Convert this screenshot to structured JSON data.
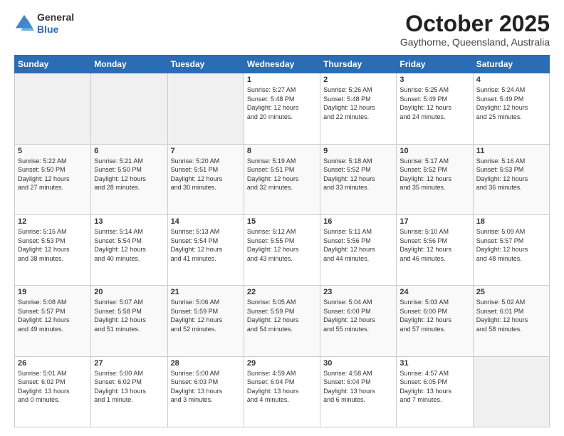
{
  "logo": {
    "general": "General",
    "blue": "Blue"
  },
  "header": {
    "month": "October 2025",
    "location": "Gaythorne, Queensland, Australia"
  },
  "weekdays": [
    "Sunday",
    "Monday",
    "Tuesday",
    "Wednesday",
    "Thursday",
    "Friday",
    "Saturday"
  ],
  "weeks": [
    [
      {
        "day": "",
        "info": ""
      },
      {
        "day": "",
        "info": ""
      },
      {
        "day": "",
        "info": ""
      },
      {
        "day": "1",
        "info": "Sunrise: 5:27 AM\nSunset: 5:48 PM\nDaylight: 12 hours\nand 20 minutes."
      },
      {
        "day": "2",
        "info": "Sunrise: 5:26 AM\nSunset: 5:48 PM\nDaylight: 12 hours\nand 22 minutes."
      },
      {
        "day": "3",
        "info": "Sunrise: 5:25 AM\nSunset: 5:49 PM\nDaylight: 12 hours\nand 24 minutes."
      },
      {
        "day": "4",
        "info": "Sunrise: 5:24 AM\nSunset: 5:49 PM\nDaylight: 12 hours\nand 25 minutes."
      }
    ],
    [
      {
        "day": "5",
        "info": "Sunrise: 5:22 AM\nSunset: 5:50 PM\nDaylight: 12 hours\nand 27 minutes."
      },
      {
        "day": "6",
        "info": "Sunrise: 5:21 AM\nSunset: 5:50 PM\nDaylight: 12 hours\nand 28 minutes."
      },
      {
        "day": "7",
        "info": "Sunrise: 5:20 AM\nSunset: 5:51 PM\nDaylight: 12 hours\nand 30 minutes."
      },
      {
        "day": "8",
        "info": "Sunrise: 5:19 AM\nSunset: 5:51 PM\nDaylight: 12 hours\nand 32 minutes."
      },
      {
        "day": "9",
        "info": "Sunrise: 5:18 AM\nSunset: 5:52 PM\nDaylight: 12 hours\nand 33 minutes."
      },
      {
        "day": "10",
        "info": "Sunrise: 5:17 AM\nSunset: 5:52 PM\nDaylight: 12 hours\nand 35 minutes."
      },
      {
        "day": "11",
        "info": "Sunrise: 5:16 AM\nSunset: 5:53 PM\nDaylight: 12 hours\nand 36 minutes."
      }
    ],
    [
      {
        "day": "12",
        "info": "Sunrise: 5:15 AM\nSunset: 5:53 PM\nDaylight: 12 hours\nand 38 minutes."
      },
      {
        "day": "13",
        "info": "Sunrise: 5:14 AM\nSunset: 5:54 PM\nDaylight: 12 hours\nand 40 minutes."
      },
      {
        "day": "14",
        "info": "Sunrise: 5:13 AM\nSunset: 5:54 PM\nDaylight: 12 hours\nand 41 minutes."
      },
      {
        "day": "15",
        "info": "Sunrise: 5:12 AM\nSunset: 5:55 PM\nDaylight: 12 hours\nand 43 minutes."
      },
      {
        "day": "16",
        "info": "Sunrise: 5:11 AM\nSunset: 5:56 PM\nDaylight: 12 hours\nand 44 minutes."
      },
      {
        "day": "17",
        "info": "Sunrise: 5:10 AM\nSunset: 5:56 PM\nDaylight: 12 hours\nand 46 minutes."
      },
      {
        "day": "18",
        "info": "Sunrise: 5:09 AM\nSunset: 5:57 PM\nDaylight: 12 hours\nand 48 minutes."
      }
    ],
    [
      {
        "day": "19",
        "info": "Sunrise: 5:08 AM\nSunset: 5:57 PM\nDaylight: 12 hours\nand 49 minutes."
      },
      {
        "day": "20",
        "info": "Sunrise: 5:07 AM\nSunset: 5:58 PM\nDaylight: 12 hours\nand 51 minutes."
      },
      {
        "day": "21",
        "info": "Sunrise: 5:06 AM\nSunset: 5:59 PM\nDaylight: 12 hours\nand 52 minutes."
      },
      {
        "day": "22",
        "info": "Sunrise: 5:05 AM\nSunset: 5:59 PM\nDaylight: 12 hours\nand 54 minutes."
      },
      {
        "day": "23",
        "info": "Sunrise: 5:04 AM\nSunset: 6:00 PM\nDaylight: 12 hours\nand 55 minutes."
      },
      {
        "day": "24",
        "info": "Sunrise: 5:03 AM\nSunset: 6:00 PM\nDaylight: 12 hours\nand 57 minutes."
      },
      {
        "day": "25",
        "info": "Sunrise: 5:02 AM\nSunset: 6:01 PM\nDaylight: 12 hours\nand 58 minutes."
      }
    ],
    [
      {
        "day": "26",
        "info": "Sunrise: 5:01 AM\nSunset: 6:02 PM\nDaylight: 13 hours\nand 0 minutes."
      },
      {
        "day": "27",
        "info": "Sunrise: 5:00 AM\nSunset: 6:02 PM\nDaylight: 13 hours\nand 1 minute."
      },
      {
        "day": "28",
        "info": "Sunrise: 5:00 AM\nSunset: 6:03 PM\nDaylight: 13 hours\nand 3 minutes."
      },
      {
        "day": "29",
        "info": "Sunrise: 4:59 AM\nSunset: 6:04 PM\nDaylight: 13 hours\nand 4 minutes."
      },
      {
        "day": "30",
        "info": "Sunrise: 4:58 AM\nSunset: 6:04 PM\nDaylight: 13 hours\nand 6 minutes."
      },
      {
        "day": "31",
        "info": "Sunrise: 4:57 AM\nSunset: 6:05 PM\nDaylight: 13 hours\nand 7 minutes."
      },
      {
        "day": "",
        "info": ""
      }
    ]
  ]
}
